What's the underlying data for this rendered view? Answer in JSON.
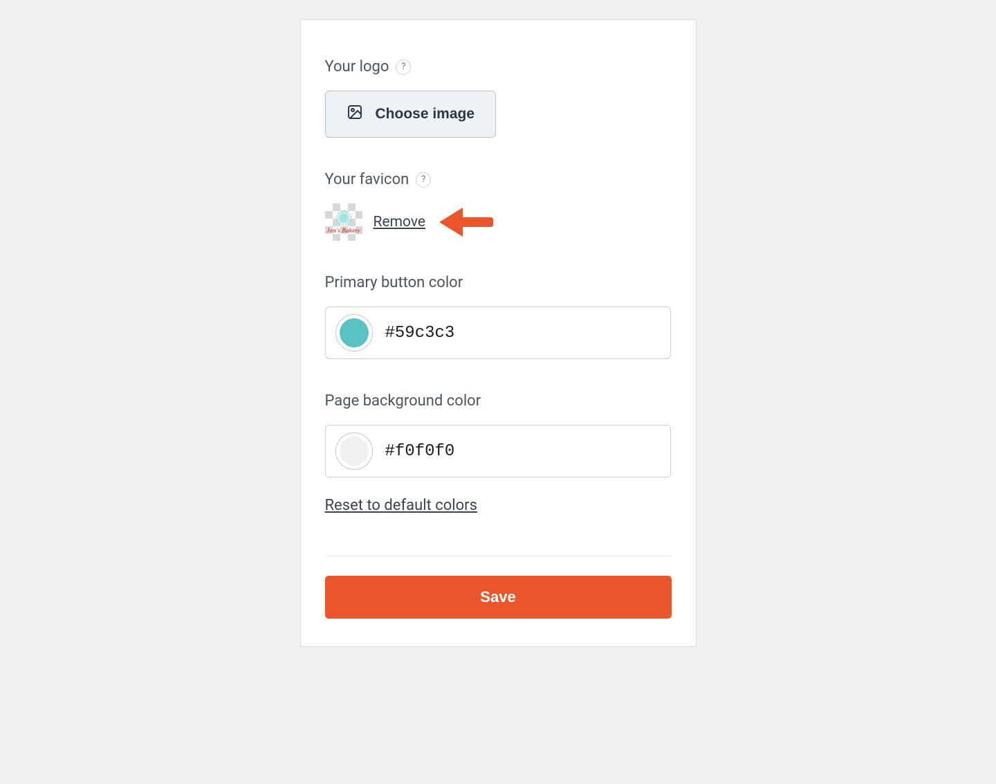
{
  "logo_section": {
    "label": "Your logo",
    "help": "?",
    "button_label": "Choose image"
  },
  "favicon_section": {
    "label": "Your favicon",
    "help": "?",
    "thumb_text": "Jen's Bakery",
    "remove_label": "Remove"
  },
  "primary_button_color": {
    "label": "Primary button color",
    "value": "#59c3c3",
    "swatch": "#59c3c3"
  },
  "page_bg_color": {
    "label": "Page background color",
    "value": "#f0f0f0",
    "swatch": "#f0f0f0"
  },
  "reset_link": "Reset to default colors",
  "save_button": "Save",
  "annotation_arrow_color": "#ea552b"
}
